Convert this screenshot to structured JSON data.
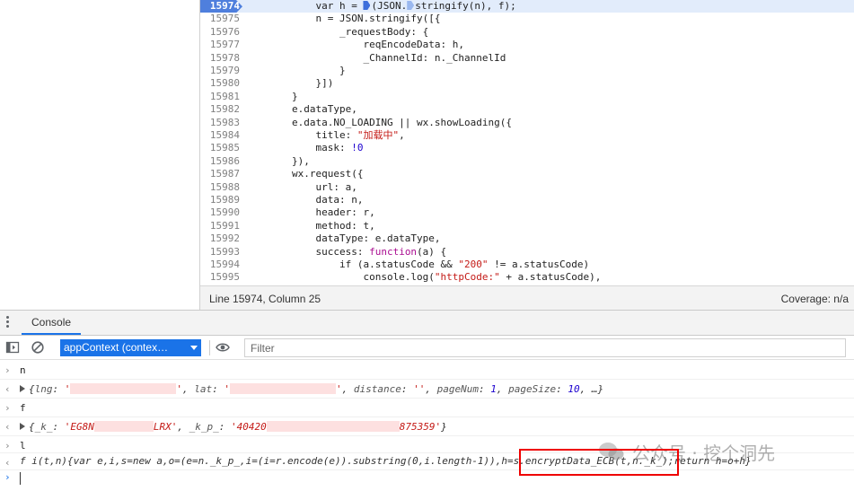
{
  "source": {
    "lines": [
      {
        "n": "15974",
        "active": true,
        "code": "            var h = ",
        "tail": "(JSON.",
        "tail2": "stringify(n), f);"
      },
      {
        "n": "15975",
        "code": "            n = JSON.stringify([{"
      },
      {
        "n": "15976",
        "code": "                _requestBody: {"
      },
      {
        "n": "15977",
        "code": "                    reqEncodeData: h,"
      },
      {
        "n": "15978",
        "code": "                    _ChannelId: n._ChannelId"
      },
      {
        "n": "15979",
        "code": "                }"
      },
      {
        "n": "15980",
        "code": "            }])"
      },
      {
        "n": "15981",
        "code": "        }"
      },
      {
        "n": "15982",
        "code": "        e.dataType,"
      },
      {
        "n": "15983",
        "code": "        e.data.NO_LOADING || wx.showLoading({"
      },
      {
        "n": "15984",
        "code": "            title: ",
        "str": "\"加载中\"",
        "after": ","
      },
      {
        "n": "15985",
        "code": "            mask: ",
        "num": "!0"
      },
      {
        "n": "15986",
        "code": "        }),"
      },
      {
        "n": "15987",
        "code": "        wx.request({"
      },
      {
        "n": "15988",
        "code": "            url: a,"
      },
      {
        "n": "15989",
        "code": "            data: n,"
      },
      {
        "n": "15990",
        "code": "            header: r,"
      },
      {
        "n": "15991",
        "code": "            method: t,"
      },
      {
        "n": "15992",
        "code": "            dataType: e.dataType,"
      },
      {
        "n": "15993",
        "code": "            success: ",
        "kw": "function",
        "after": "(a) {"
      },
      {
        "n": "15994",
        "code": "                if (a.statusCode && ",
        "str": "\"200\"",
        "after": " != a.statusCode)"
      },
      {
        "n": "15995",
        "code": "                    console.log(",
        "str": "\"httpCode:\"",
        "after": " + a.statusCode),"
      }
    ],
    "status_position": "Line 15974, Column 25",
    "status_coverage": "Coverage: n/a"
  },
  "drawer": {
    "tab_console": "Console"
  },
  "toolbar": {
    "context": "appContext (contex…",
    "filter_placeholder": "Filter"
  },
  "console": {
    "cmd1": "n",
    "res1": {
      "k1": "lng",
      "v1a": "'",
      "v1b": "'",
      "k2": "lat",
      "v2a": "'",
      "v2b": "'",
      "k3": "distance",
      "v3": "''",
      "k4": "pageNum",
      "v4": "1",
      "k5": "pageSize",
      "v5": "10",
      "more": "…"
    },
    "cmd2": "f",
    "res2": {
      "k1": "_k_",
      "v1a": "'EG8N",
      "v1b": "LRX'",
      "k2": "_k_p_",
      "v2a": "'40420",
      "v2b": "875359'"
    },
    "cmd3": "l",
    "res3": "f i(t,n){var e,i,s=new a,o=(e=n._k_p_,i=(i=r.encode(e)).substring(0,i.length-1)),h=s.encryptData_ECB(t,n._k_);return h=o+h}",
    "watermark": "公众号 · 挖个洞先"
  },
  "colors": {
    "accent": "#1a73e8",
    "highlight_box": "#ef0000",
    "active_line": "#e2ecfb"
  }
}
